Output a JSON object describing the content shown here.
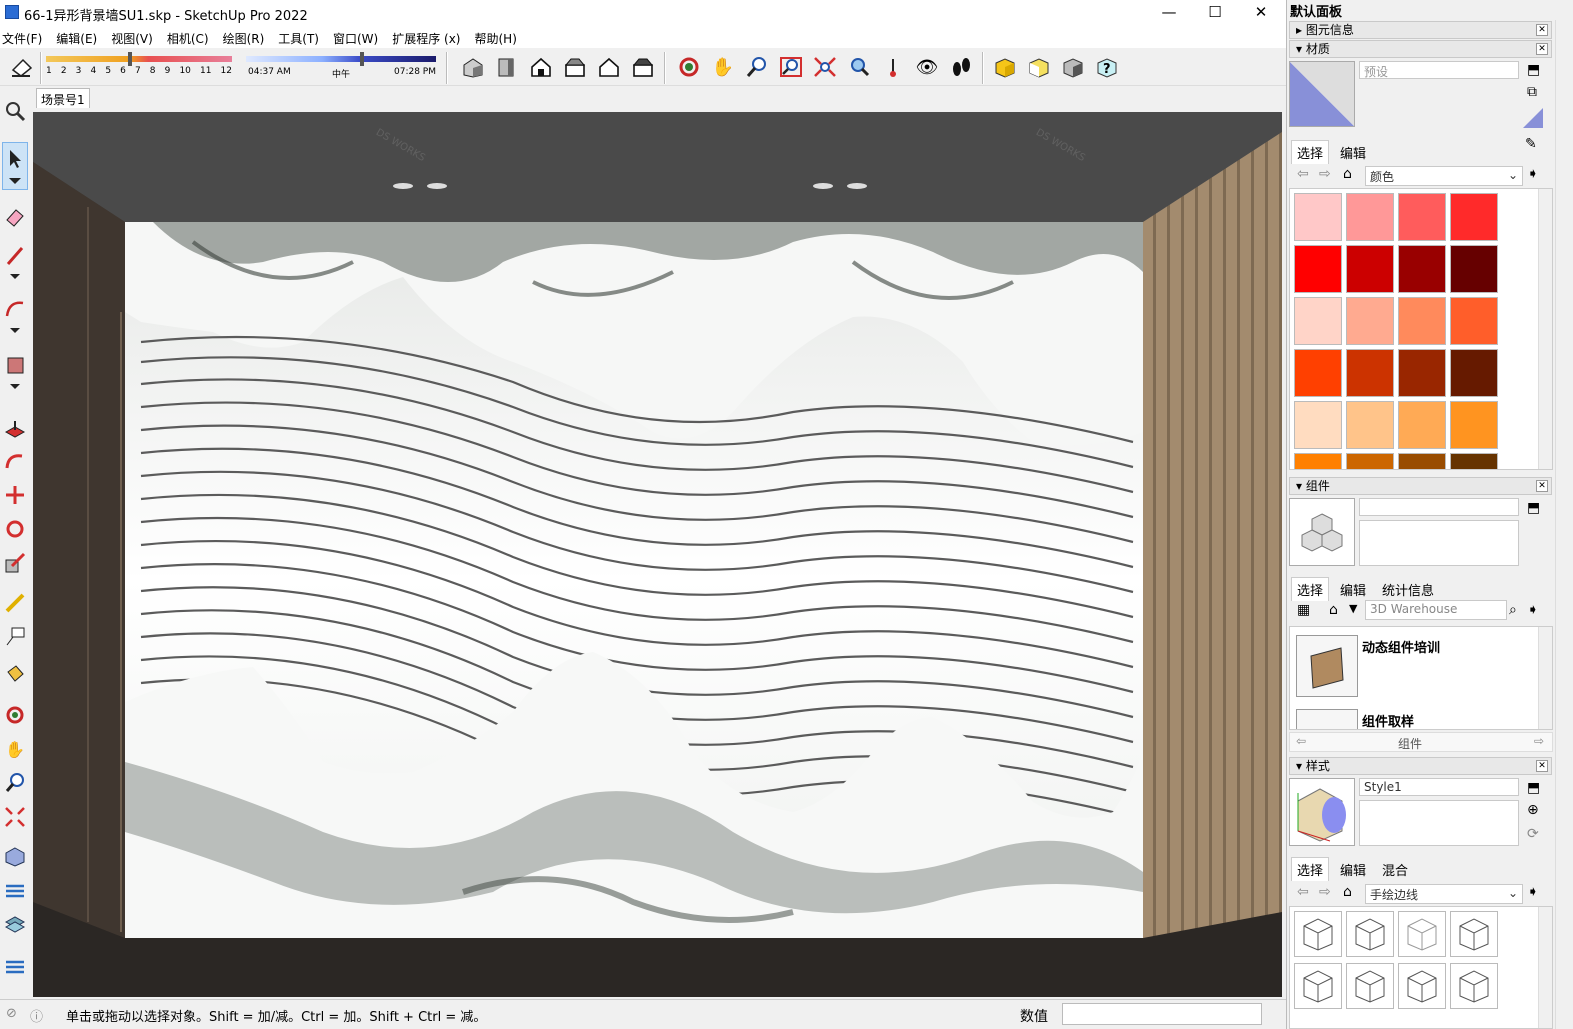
{
  "window": {
    "title": "66-1异形背景墙SU1.skp - SketchUp Pro 2022",
    "minimize": "—",
    "maximize": "☐",
    "close": "✕"
  },
  "menu": [
    "文件(F)",
    "编辑(E)",
    "视图(V)",
    "相机(C)",
    "绘图(R)",
    "工具(T)",
    "窗口(W)",
    "扩展程序 (x)",
    "帮助(H)"
  ],
  "shadow": {
    "months": [
      "1",
      "2",
      "3",
      "4",
      "5",
      "6",
      "7",
      "8",
      "9",
      "10",
      "11",
      "12"
    ],
    "time_start": "04:37 AM",
    "time_mid": "中午",
    "time_end": "07:28 PM"
  },
  "scene": {
    "tab": "场景号1"
  },
  "status": {
    "message": "单击或拖动以选择对象。Shift = 加/减。Ctrl = 加。Shift + Ctrl = 减。",
    "measure_label": "数值",
    "measure_value": ""
  },
  "tray": {
    "title": "默认面板",
    "entity_info": "图元信息",
    "materials": {
      "title": "材质",
      "name_placeholder": "预设",
      "tab_select": "选择",
      "tab_edit": "编辑",
      "library": "颜色",
      "swatches": [
        "#ffc8c8",
        "#ff9898",
        "#ff5c5c",
        "#ff2a2a",
        "#ff0000",
        "#cc0000",
        "#990000",
        "#660000",
        "#ffd4c8",
        "#ffaa90",
        "#ff8a5c",
        "#ff5e2a",
        "#ff4000",
        "#cc3300",
        "#992600",
        "#661a00",
        "#ffdcc0",
        "#ffc48a",
        "#ffaa55",
        "#ff9420",
        "#ff8000",
        "#cc6600",
        "#994c00",
        "#663300"
      ]
    },
    "components": {
      "title": "组件",
      "tab_select": "选择",
      "tab_edit": "编辑",
      "tab_stats": "统计信息",
      "search_placeholder": "3D Warehouse",
      "items": [
        "动态组件培训",
        "组件取样"
      ],
      "footer": "组件"
    },
    "styles": {
      "title": "样式",
      "name": "Style1",
      "tab_select": "选择",
      "tab_edit": "编辑",
      "tab_mix": "混合",
      "library": "手绘边线"
    }
  },
  "colors": {
    "ceiling": "#4a4a4a",
    "floor": "#2e2a28",
    "wood_wall": "#3f362f",
    "slats": "#a38b6e",
    "marble": "#f3f4f2",
    "selection": "#cde3f6"
  },
  "watermark": "DS WORKS"
}
